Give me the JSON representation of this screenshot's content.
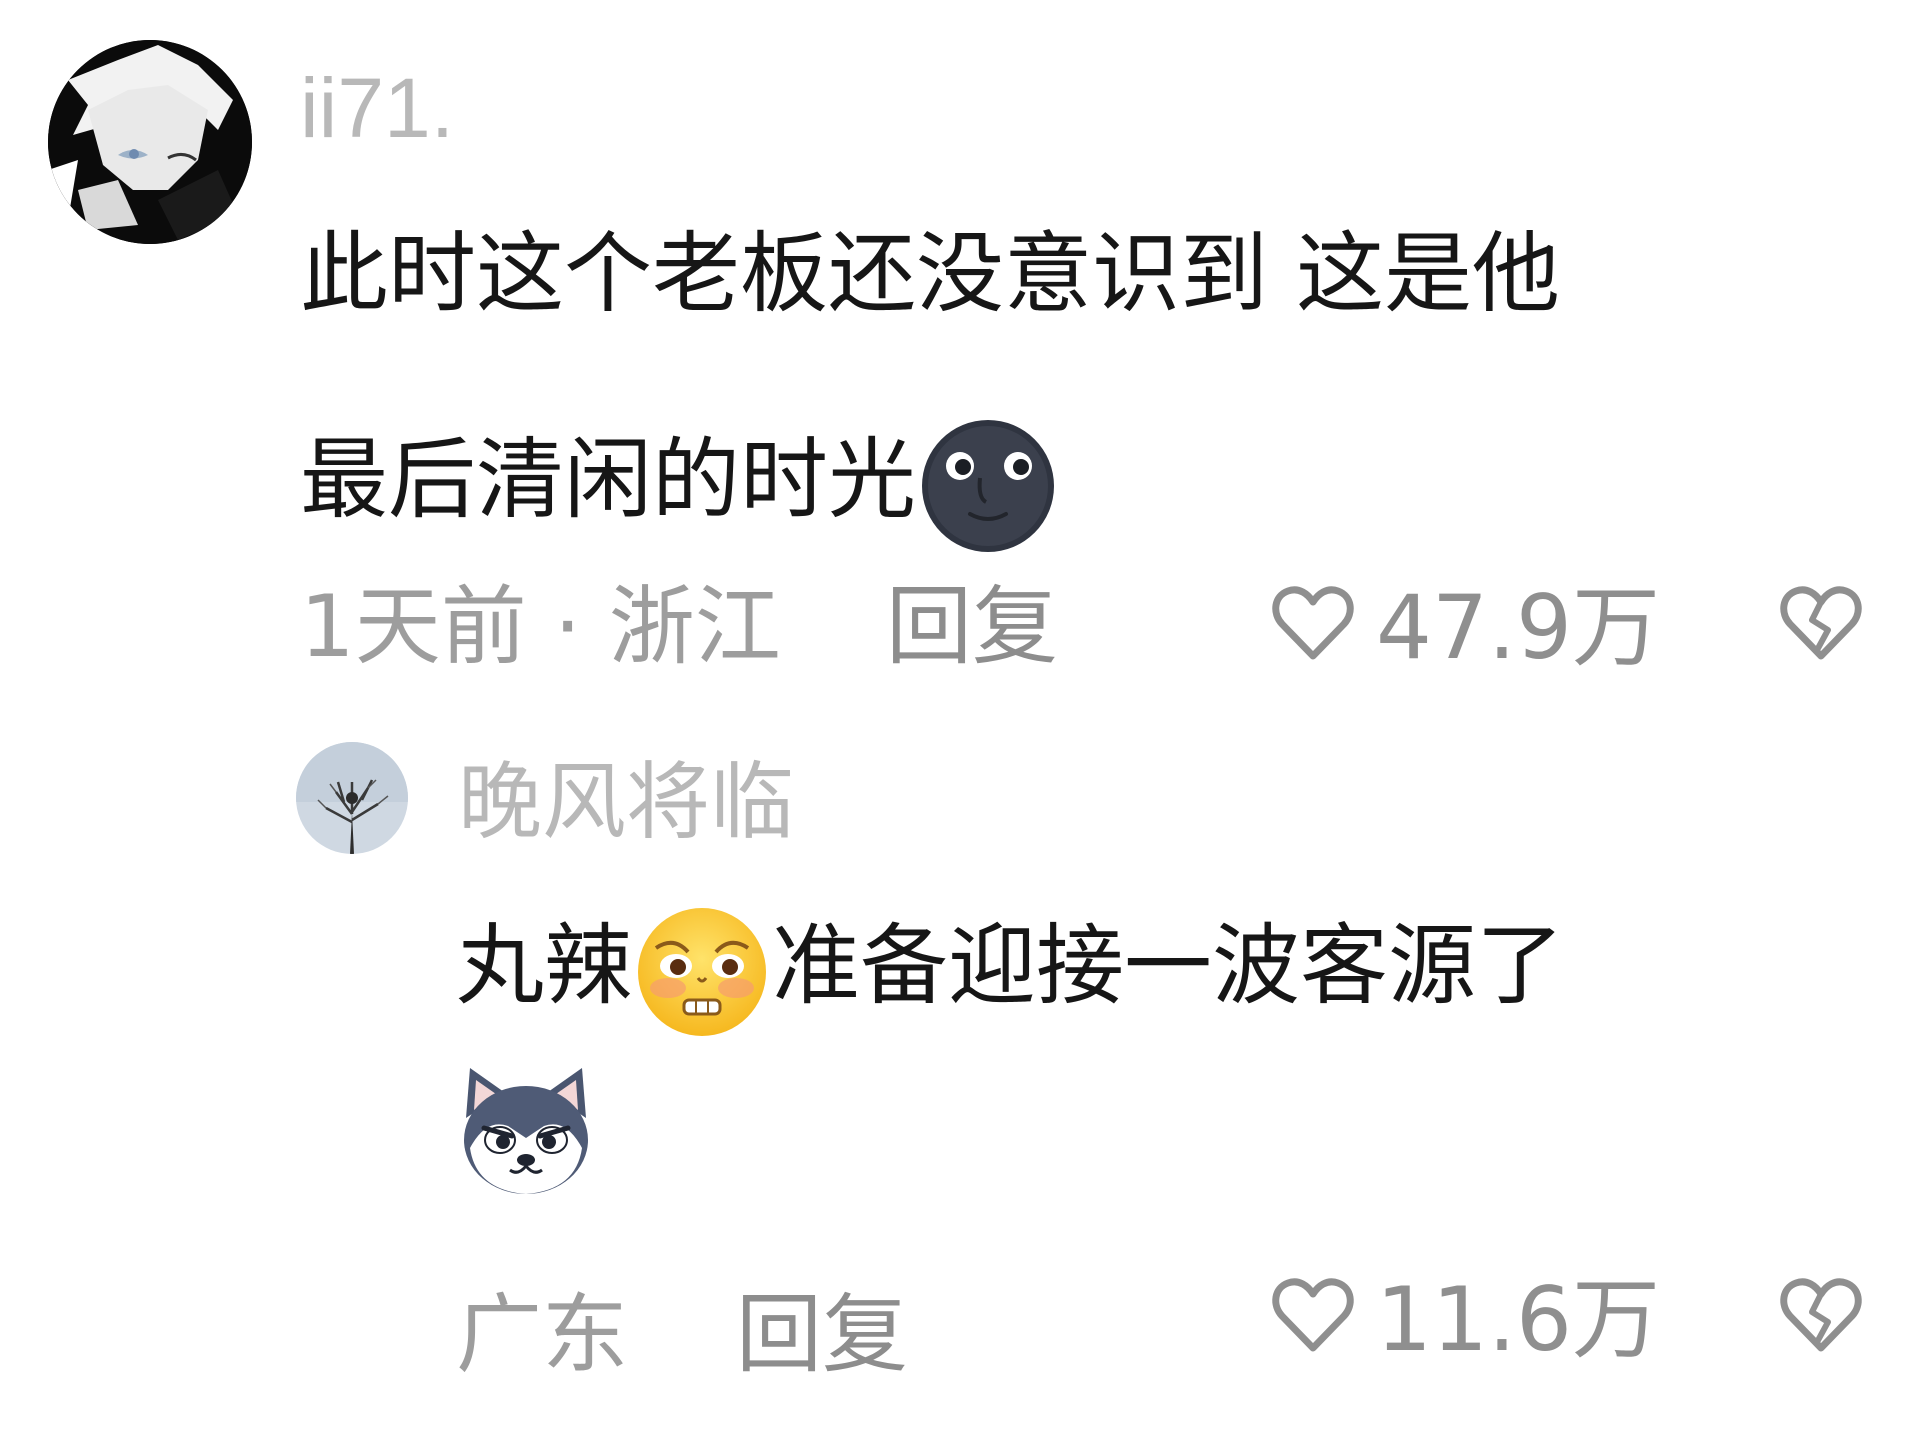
{
  "comments": [
    {
      "username": "ii71.",
      "text_line1": "此时这个老板还没意识到 这是他",
      "text_line2": "最后清闲的时光",
      "text_emoji": "new-moon-face",
      "time_location": "1天前 · 浙江",
      "reply_label": "回复",
      "likes": "47.9万",
      "avatar": "anime-white-hair-avatar"
    },
    {
      "username": "晚风将临",
      "text_part1": "丸辣",
      "text_emoji": "pleading-face",
      "text_part2": "准备迎接一波客源了",
      "sticker": "husky-dog-face",
      "location": "广东",
      "reply_label": "回复",
      "likes": "11.6万",
      "avatar": "bare-tree-sky-avatar"
    }
  ],
  "icons": {
    "like": "heart-outline-icon",
    "dislike": "broken-heart-icon"
  },
  "colors": {
    "username": "#b8b8b8",
    "text": "#161616",
    "meta": "#9d9d9d",
    "icon": "#8f8f8f",
    "background": "#ffffff"
  }
}
